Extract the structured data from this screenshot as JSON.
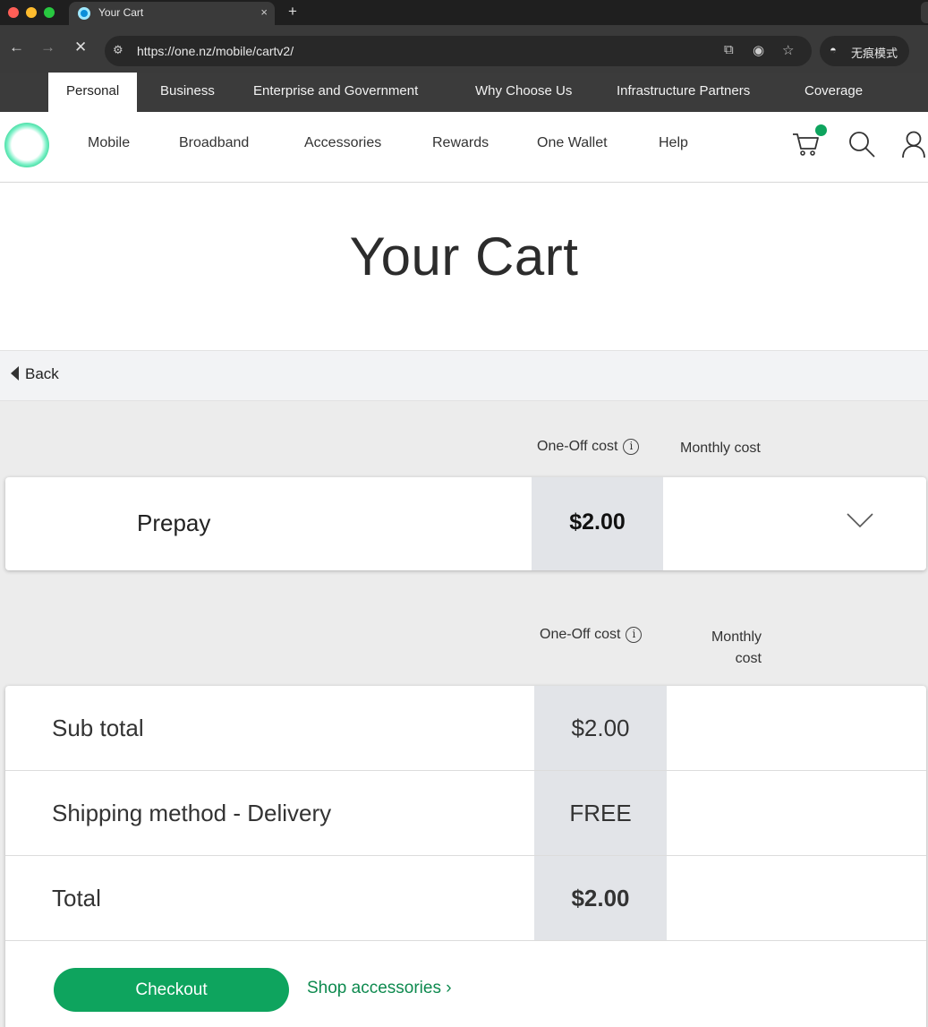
{
  "browser": {
    "tab_title": "Your Cart",
    "tab_close": "×",
    "new_tab": "+",
    "url": "https://one.nz/mobile/cartv2/",
    "incognito_label": "无痕模式"
  },
  "segment_nav": {
    "items": [
      "Personal",
      "Business",
      "Enterprise and Government",
      "Why Choose Us",
      "Infrastructure Partners",
      "Coverage"
    ],
    "active": "Personal"
  },
  "main_nav": {
    "items": [
      "Mobile",
      "Broadband",
      "Accessories",
      "Rewards",
      "One Wallet",
      "Help"
    ]
  },
  "page": {
    "title": "Your Cart",
    "back_label": "Back"
  },
  "cart": {
    "col_one_off": "One-Off cost",
    "col_monthly": "Monthly cost",
    "col_monthly_line1": "Monthly",
    "col_monthly_line2": "cost",
    "info_glyph": "i",
    "items": [
      {
        "name": "Prepay",
        "one_off": "$2.00",
        "monthly": ""
      }
    ]
  },
  "totals": {
    "rows": [
      {
        "label": "Sub total",
        "one_off": "$2.00",
        "bold": false
      },
      {
        "label": "Shipping method - Delivery",
        "one_off": "FREE",
        "bold": false
      },
      {
        "label": "Total",
        "one_off": "$2.00",
        "bold": true
      }
    ],
    "checkout_label": "Checkout",
    "shop_link": "Shop accessories ›"
  },
  "colors": {
    "brand_green": "#0ea45e",
    "price_cell_bg": "#e2e4e8",
    "nav_dark": "#3b3b3b"
  },
  "icons": [
    "back-icon",
    "forward-icon",
    "stop-icon",
    "site-info-icon",
    "translate-icon",
    "eye-off-icon",
    "star-icon",
    "incognito-icon",
    "cart-icon",
    "search-icon",
    "user-icon",
    "info-icon",
    "chevron-down-icon",
    "back-caret-icon"
  ]
}
